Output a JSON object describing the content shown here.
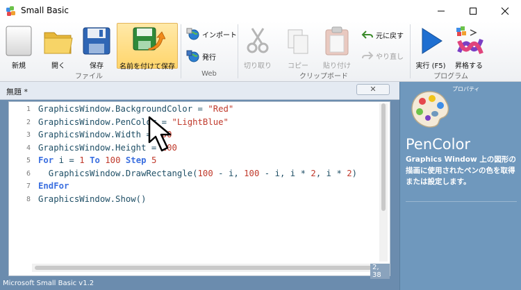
{
  "window": {
    "title": "Small Basic"
  },
  "ribbon": {
    "file_group": {
      "label": "ファイル",
      "new": "新規",
      "open": "開く",
      "save": "保存",
      "save_as": "名前を付けて保存"
    },
    "web_group": {
      "label": "Web",
      "import": "インポート",
      "publish": "発行"
    },
    "clipboard_group": {
      "label": "クリップボード",
      "cut": "切り取り",
      "copy": "コピー",
      "paste": "貼り付け",
      "undo": "元に戻す",
      "redo": "やり直し"
    },
    "program_group": {
      "label": "プログラム",
      "run": "実行 (F5)",
      "graduate": "昇格する"
    }
  },
  "editor": {
    "doc_title": "無題 *",
    "close_symbol": "✕",
    "line_numbers": [
      "1",
      "2",
      "3",
      "4",
      "5",
      "6",
      "7",
      "8"
    ],
    "cursor_position": "2, 38"
  },
  "help": {
    "category": "プロパティ",
    "title": "PenColor",
    "description": "Graphics Window 上の図形の描画に使用されたペンの色を取得または設定します。"
  },
  "status": {
    "text": "Microsoft Small Basic v1.2"
  },
  "colors": {
    "accent": "#6b8cae",
    "keyword": "#3b6fe0",
    "literal": "#c0392b",
    "identifier": "#1f4f66"
  }
}
